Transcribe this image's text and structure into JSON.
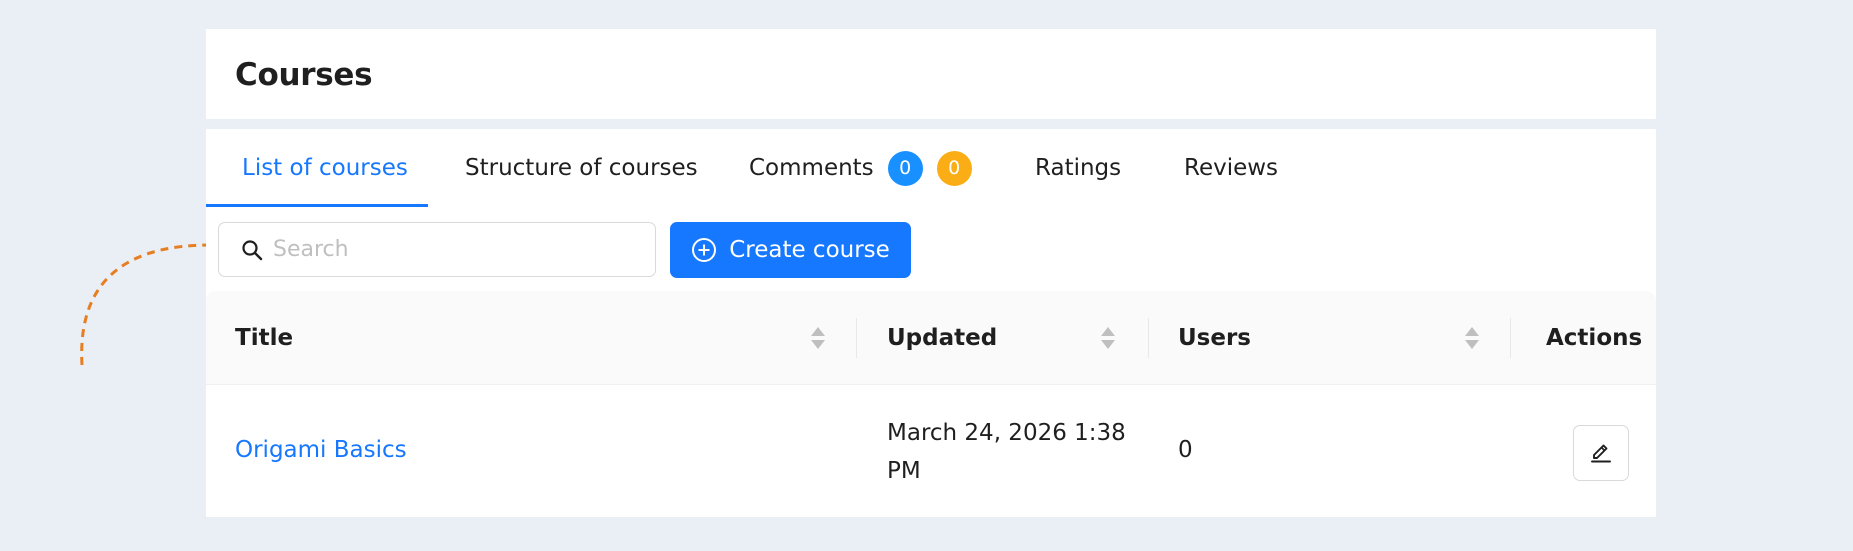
{
  "header": {
    "title": "Courses"
  },
  "tabs": [
    {
      "label": "List of courses",
      "active": true
    },
    {
      "label": "Structure of courses",
      "active": false
    },
    {
      "label": "Comments",
      "active": false,
      "badges": [
        "0",
        "0"
      ]
    },
    {
      "label": "Ratings",
      "active": false
    },
    {
      "label": "Reviews",
      "active": false
    }
  ],
  "toolbar": {
    "search_placeholder": "Search",
    "search_value": "",
    "create_label": "Create course"
  },
  "table": {
    "columns": [
      "Title",
      "Updated",
      "Users",
      "Actions"
    ],
    "rows": [
      {
        "title": "Origami Basics",
        "updated": "March 24, 2026 1:38 PM",
        "users": "0"
      }
    ]
  },
  "colors": {
    "accent": "#1677ff",
    "badge_blue": "#1890ff",
    "badge_orange": "#faad14",
    "background": "#eaeef5",
    "annotation_arrow": "#e67e22"
  },
  "icons": {
    "search": "search-icon",
    "create": "plus-circle-icon",
    "edit": "edit-icon",
    "sort": "sort-icon"
  }
}
